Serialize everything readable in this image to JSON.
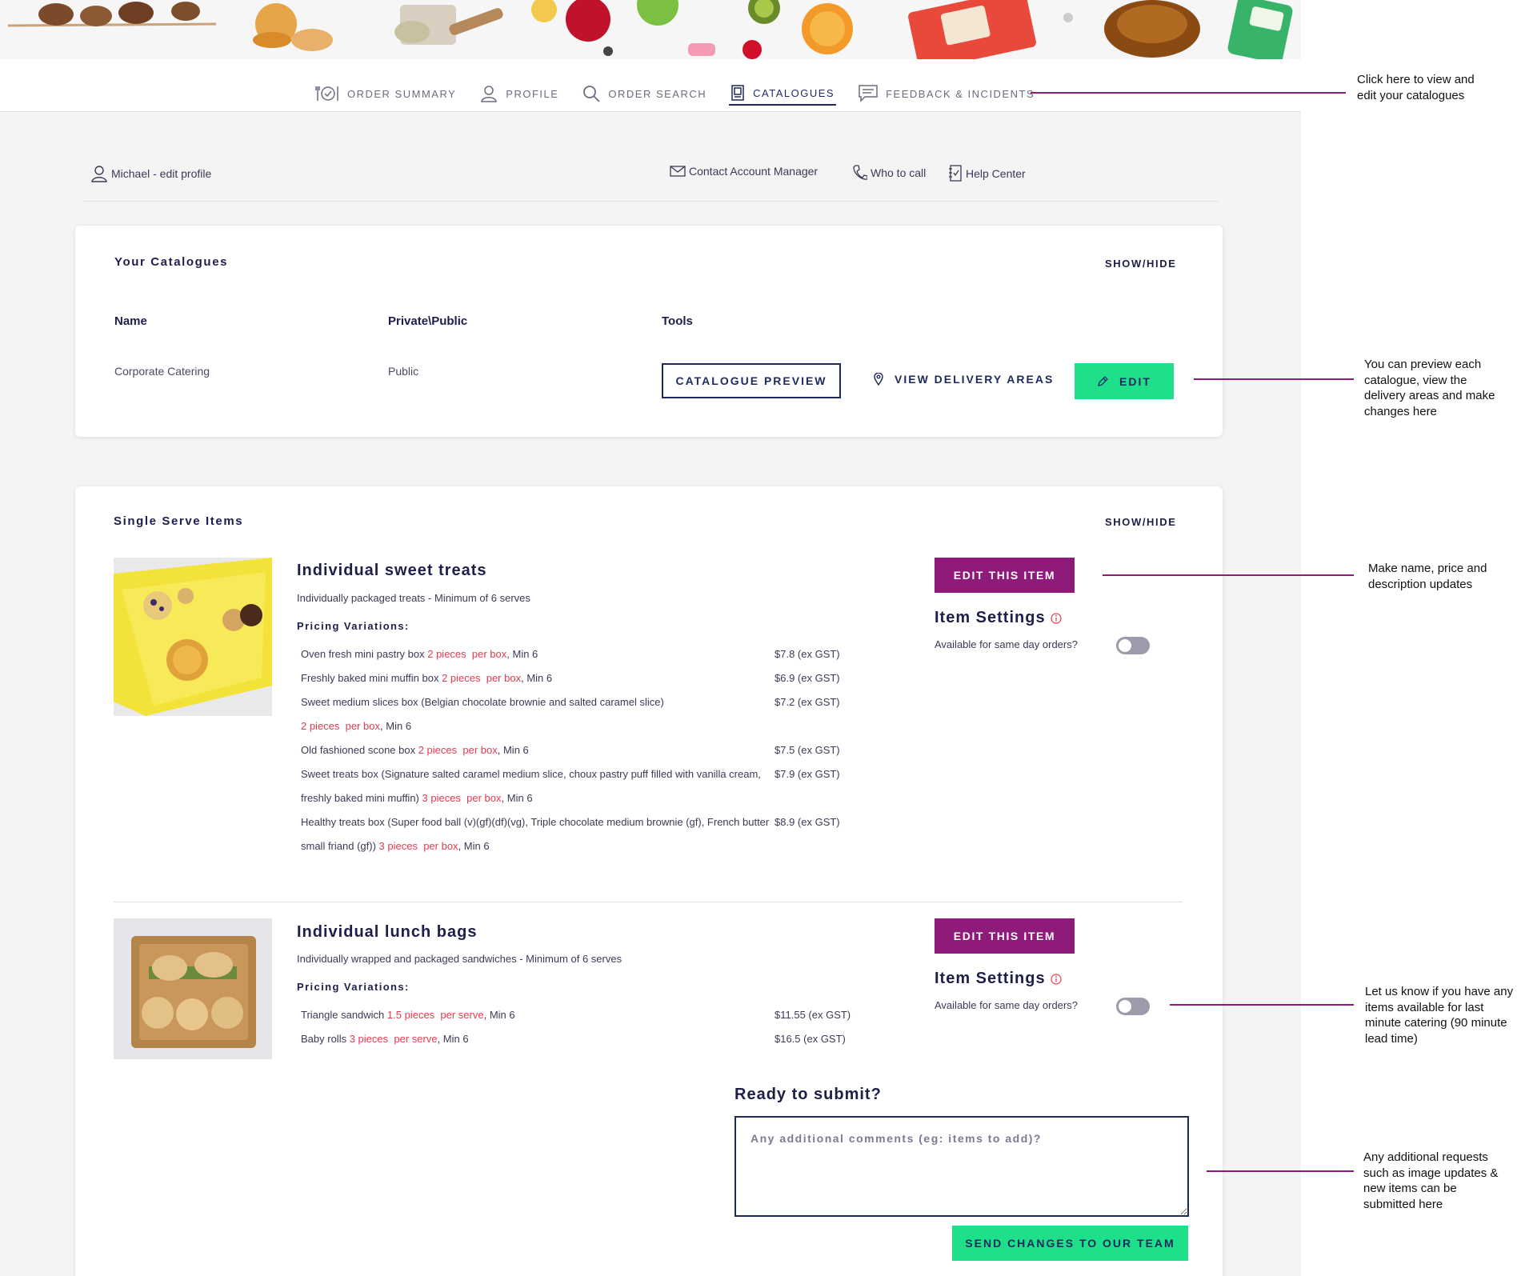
{
  "nav": {
    "items": [
      {
        "label": "ORDER SUMMARY",
        "icon": "dining-icon",
        "active": false
      },
      {
        "label": "PROFILE",
        "icon": "user-icon",
        "active": false
      },
      {
        "label": "ORDER SEARCH",
        "icon": "search-icon",
        "active": false
      },
      {
        "label": "CATALOGUES",
        "icon": "catalogue-icon",
        "active": true
      },
      {
        "label": "FEEDBACK & INCIDENTS",
        "icon": "chat-icon",
        "active": false
      }
    ]
  },
  "topbar": {
    "profile_link": "Michael - edit profile",
    "contact_link": "Contact Account Manager",
    "call_link": "Who to call",
    "help_link": "Help Center"
  },
  "catalogues_card": {
    "title": "Your Catalogues",
    "show_hide": "SHOW/HIDE",
    "headers": {
      "name": "Name",
      "visibility": "Private\\Public",
      "tools": "Tools"
    },
    "row": {
      "name": "Corporate Catering",
      "visibility": "Public",
      "preview_label": "CATALOGUE PREVIEW",
      "delivery_label": "VIEW DELIVERY AREAS",
      "edit_label": "EDIT"
    }
  },
  "items_card": {
    "title": "Single Serve Items",
    "show_hide": "SHOW/HIDE",
    "items": [
      {
        "title": "Individual sweet treats",
        "description": "Individually packaged treats - Minimum of 6 serves",
        "pricing_label": "Pricing Variations:",
        "edit_label": "EDIT THIS ITEM",
        "settings_title": "Item Settings",
        "same_day_label": "Available for same day orders?",
        "same_day_available": false,
        "variations": [
          {
            "text": "Oven fresh mini pastry box ",
            "pieces": "2 pieces",
            "per": "per box",
            "min": ", Min 6",
            "price": "$7.8 (ex GST)"
          },
          {
            "text": "Freshly baked mini muffin box ",
            "pieces": "2 pieces",
            "per": "per box",
            "min": ", Min 6",
            "price": "$6.9 (ex GST)"
          },
          {
            "text": "Sweet medium slices box (Belgian chocolate brownie and salted caramel slice)",
            "pieces": "2 pieces",
            "per": "per box",
            "min": ", Min 6",
            "price": "$7.2 (ex GST)",
            "wrap": true
          },
          {
            "text": "Old fashioned scone box ",
            "pieces": "2 pieces",
            "per": "per box",
            "min": ", Min 6",
            "price": "$7.5 (ex GST)"
          },
          {
            "text": "Sweet treats box (Signature salted caramel medium slice, choux pastry puff filled with vanilla cream, freshly baked mini muffin) ",
            "pieces": "3 pieces",
            "per": "per box",
            "min": ", Min 6",
            "price": "$7.9 (ex GST)"
          },
          {
            "text": "Healthy treats box (Super food ball (v)(gf)(df)(vg), Triple chocolate medium brownie (gf), French butter small friand (gf)) ",
            "pieces": "3 pieces",
            "per": "per box",
            "min": ", Min 6",
            "price": "$8.9 (ex GST)"
          }
        ]
      },
      {
        "title": "Individual lunch bags",
        "description": "Individually wrapped and packaged sandwiches - Minimum of 6 serves",
        "pricing_label": "Pricing Variations:",
        "edit_label": "EDIT THIS ITEM",
        "settings_title": "Item Settings",
        "same_day_label": "Available for same day orders?",
        "same_day_available": false,
        "variations": [
          {
            "text": "Triangle sandwich ",
            "pieces": "1.5 pieces",
            "per": "per serve",
            "min": ", Min 6",
            "price": "$11.55 (ex GST)"
          },
          {
            "text": "Baby rolls ",
            "pieces": "3 pieces",
            "per": "per serve",
            "min": ", Min 6",
            "price": "$16.5 (ex GST)"
          }
        ]
      }
    ]
  },
  "submit": {
    "title": "Ready to submit?",
    "placeholder": "Any additional comments (eg: items to add)?",
    "send_label": "SEND CHANGES TO OUR TEAM"
  },
  "annotations": [
    {
      "text": "Click here to view and edit your catalogues"
    },
    {
      "text": "You can preview each catalogue, view the delivery areas and make changes here"
    },
    {
      "text": "Make name, price and description updates"
    },
    {
      "text": "Let us know if you have any items available for last minute catering (90 minute lead time)"
    },
    {
      "text": "Any additional requests such as image updates & new items can be submitted here"
    }
  ],
  "colors": {
    "navy": "#1e2a5e",
    "purple": "#8e1a7a",
    "green": "#1ee08a",
    "red": "#e8384f"
  }
}
